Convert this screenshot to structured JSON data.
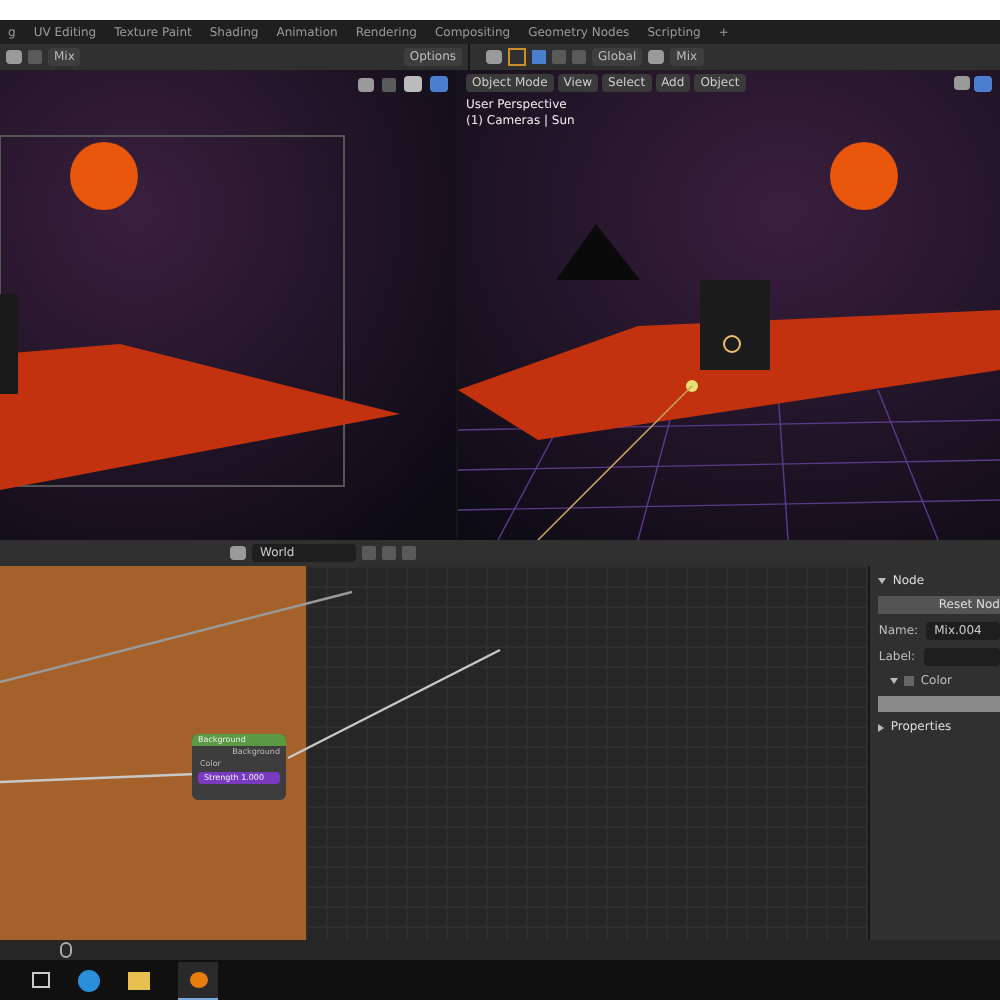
{
  "tabs": [
    {
      "label": "g",
      "selected": false
    },
    {
      "label": "UV Editing",
      "selected": false
    },
    {
      "label": "Texture Paint",
      "selected": false
    },
    {
      "label": "Shading",
      "selected": false
    },
    {
      "label": "Animation",
      "selected": false
    },
    {
      "label": "Rendering",
      "selected": false
    },
    {
      "label": "Compositing",
      "selected": false
    },
    {
      "label": "Geometry Nodes",
      "selected": false
    },
    {
      "label": "Scripting",
      "selected": false
    }
  ],
  "add_tab": "+",
  "left_header": {
    "blend_mode": "Mix",
    "options": "Options"
  },
  "right_header": {
    "orientation": "Global",
    "blend_mode": "Mix"
  },
  "viewport_menu": {
    "mode": "Object Mode",
    "menus": [
      "View",
      "Select",
      "Add",
      "Object"
    ]
  },
  "viewport_overlay": {
    "view": "User Perspective",
    "collection": "(1) Cameras | Sun"
  },
  "node_editor": {
    "world": "World",
    "node": {
      "title": "Background",
      "output": "Background",
      "inputs": [
        {
          "kind": "socket",
          "label": "Color"
        },
        {
          "kind": "field",
          "label": "Strength",
          "value": "1.000"
        }
      ]
    }
  },
  "sidebar": {
    "panel": {
      "label": "Node",
      "expanded": true
    },
    "reset": "Reset Nod",
    "name_label": "Name:",
    "name_value": "Mix.004",
    "label_label": "Label:",
    "color_section": {
      "label": "Color",
      "expanded": true,
      "checked": false
    },
    "properties_section": {
      "label": "Properties",
      "expanded": false
    }
  }
}
